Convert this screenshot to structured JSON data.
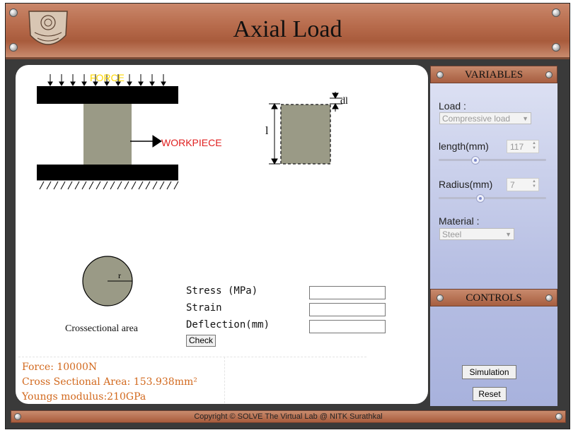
{
  "header": {
    "title": "Axial Load"
  },
  "diagram": {
    "force_label": "FORCE",
    "workpiece_label": "WORKPIECE",
    "length_symbol": "l",
    "deflection_symbol": "dl",
    "radius_symbol": "r",
    "cross_section_caption": "Crossectional area",
    "colors": {
      "workpiece": "#9a9a86",
      "force_label": "#ffd700",
      "workpiece_label": "#e02020"
    }
  },
  "results": {
    "stress_label": "Stress (MPa)",
    "strain_label": "Strain",
    "deflection_label": "Deflection(mm)",
    "stress_value": "",
    "strain_value": "",
    "deflection_value": "",
    "check_label": "Check"
  },
  "info": {
    "force": "Force: 10000N",
    "area": "Cross Sectional Area: 153.938mm²",
    "modulus": "Youngs modulus:210GPa"
  },
  "variables": {
    "title": "VARIABLES",
    "load_label": "Load :",
    "load_value": "Compressive load",
    "length_label": "length(mm)",
    "length_value": "117",
    "length_slider_fraction": 0.33,
    "radius_label": "Radius(mm)",
    "radius_value": "7",
    "radius_slider_fraction": 0.38,
    "material_label": "Material :",
    "material_value": "Steel"
  },
  "controls": {
    "title": "CONTROLS",
    "simulation_label": "Simulation",
    "reset_label": "Reset"
  },
  "footer": {
    "copyright": "Copyright © SOLVE The Virtual Lab @ NITK Surathkal"
  }
}
